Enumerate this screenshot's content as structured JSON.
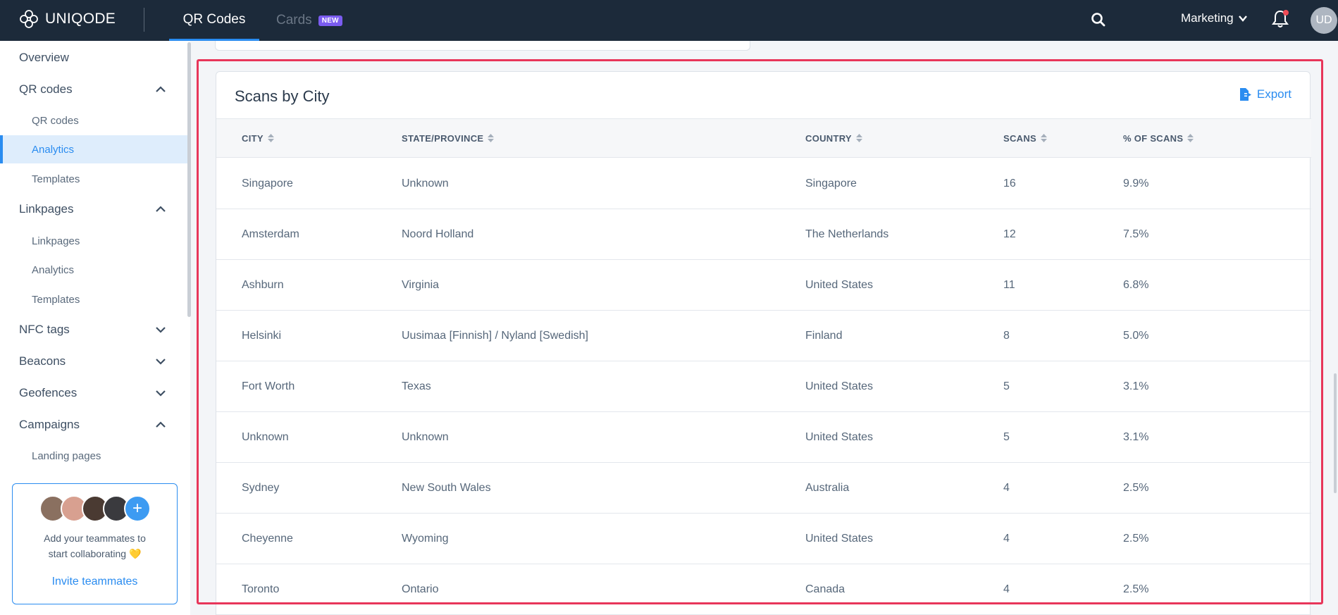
{
  "brand": {
    "name": "UNIQODE"
  },
  "topnav": {
    "tabs": [
      {
        "label": "QR Codes"
      },
      {
        "label": "Cards",
        "badge": "NEW"
      }
    ],
    "workspace": "Marketing",
    "user_initials": "UD"
  },
  "sidebar": {
    "items": [
      {
        "label": "Overview"
      },
      {
        "label": "QR codes"
      },
      {
        "label": "QR codes"
      },
      {
        "label": "Analytics"
      },
      {
        "label": "Templates"
      },
      {
        "label": "Linkpages"
      },
      {
        "label": "Linkpages"
      },
      {
        "label": "Analytics"
      },
      {
        "label": "Templates"
      },
      {
        "label": "NFC tags"
      },
      {
        "label": "Beacons"
      },
      {
        "label": "Geofences"
      },
      {
        "label": "Campaigns"
      },
      {
        "label": "Landing pages"
      }
    ],
    "invite": {
      "text_line1": "Add your teammates to",
      "text_line2": "start collaborating 💛",
      "link": "Invite teammates"
    }
  },
  "card": {
    "title": "Scans by City",
    "export_label": "Export",
    "columns": [
      "CITY",
      "STATE/PROVINCE",
      "COUNTRY",
      "SCANS",
      "% OF SCANS"
    ],
    "rows": [
      [
        "Singapore",
        "Unknown",
        "Singapore",
        "16",
        "9.9%"
      ],
      [
        "Amsterdam",
        "Noord Holland",
        "The Netherlands",
        "12",
        "7.5%"
      ],
      [
        "Ashburn",
        "Virginia",
        "United States",
        "11",
        "6.8%"
      ],
      [
        "Helsinki",
        "Uusimaa [Finnish] / Nyland [Swedish]",
        "Finland",
        "8",
        "5.0%"
      ],
      [
        "Fort Worth",
        "Texas",
        "United States",
        "5",
        "3.1%"
      ],
      [
        "Unknown",
        "Unknown",
        "United States",
        "5",
        "3.1%"
      ],
      [
        "Sydney",
        "New South Wales",
        "Australia",
        "4",
        "2.5%"
      ],
      [
        "Cheyenne",
        "Wyoming",
        "United States",
        "4",
        "2.5%"
      ],
      [
        "Toronto",
        "Ontario",
        "Canada",
        "4",
        "2.5%"
      ]
    ]
  },
  "colors": {
    "accent": "#2a8cf0",
    "topbar": "#1c2a3a",
    "highlight": "#e8365a",
    "badge": "#7b5cf0"
  }
}
